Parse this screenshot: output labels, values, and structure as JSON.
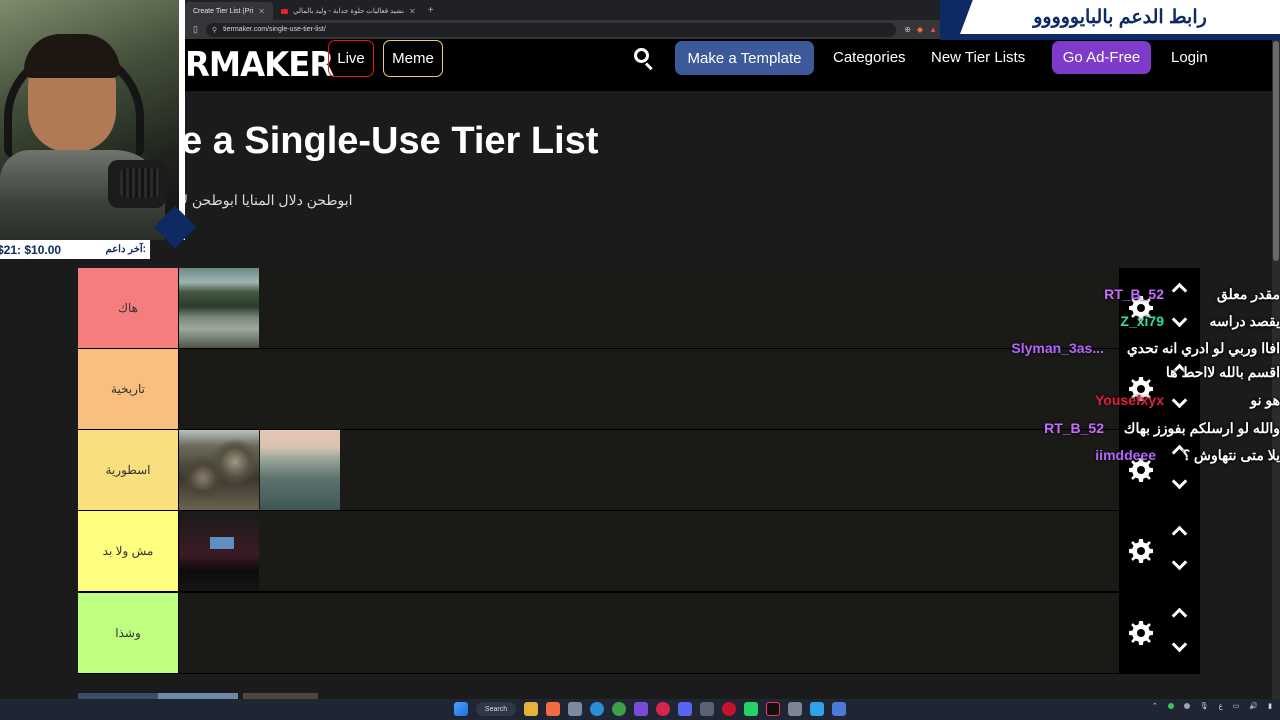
{
  "browser": {
    "tabs": [
      {
        "label": "Create Tier List (Pri",
        "active": true
      },
      {
        "label": "نشيد فعاليات حلوة جدابة - وليد بالمالي",
        "active": false
      }
    ],
    "url": "tiermaker.com/single-use-tier-list/"
  },
  "nav": {
    "logo": "RMAKER",
    "live_label": "Live",
    "meme_label": "Meme",
    "template_label": "Make a Template",
    "categories_label": "Categories",
    "new_lists_label": "New Tier Lists",
    "adfree_label": "Go Ad-Free",
    "login_label": "Login"
  },
  "page": {
    "title": "e a Single-Use Tier List",
    "subtitle": "ابوطحن دلال المنايا ابوطحن لا"
  },
  "tiers": [
    {
      "label": "هاك",
      "color": "#f47e7e",
      "images": [
        "lake"
      ]
    },
    {
      "label": "تاريخية",
      "color": "#f9bf7f",
      "images": []
    },
    {
      "label": "اسطورية",
      "color": "#fadf7f",
      "images": [
        "rocks",
        "sea"
      ]
    },
    {
      "label": "مش ولا بد",
      "color": "#fefe7f",
      "images": [
        "theatre"
      ]
    },
    {
      "label": "وشذا",
      "color": "#bfff7f",
      "images": []
    }
  ],
  "overlay": {
    "banner_text": "رابط الدعم بالبايووووو",
    "donation_label": "آخر داعم:",
    "donation_amount": "$21: $10.00"
  },
  "chat": [
    {
      "user": "RT_B_52",
      "message": "مقدر معلق",
      "color": "#c86cff"
    },
    {
      "user": "Z_xi79",
      "message": "يقصد دراسه",
      "color": "#34e0a0"
    },
    {
      "user": "Slyman_3as...",
      "message": "افاا وربي لو ادري انه تحدي اقسم بالله لااحط ها",
      "color": "#b466ff"
    },
    {
      "user": "Yousefxyx",
      "message": "هو نو",
      "color": "#e0203a"
    },
    {
      "user": "RT_B_52",
      "message": "والله لو ارسلكم بفوزز بهاك",
      "color": "#c86cff"
    },
    {
      "user": "iimddeee",
      "message": "يلا متى نتهاوش ؟",
      "color": "#b466ff"
    }
  ],
  "taskbar": {
    "search_label": "Search"
  }
}
